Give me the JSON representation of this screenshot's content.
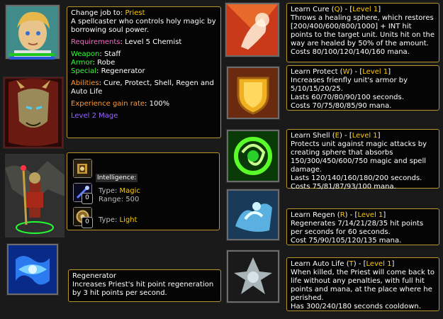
{
  "hero": {
    "change_job_label": "Change job to:",
    "job_name": "Priest",
    "description": "A spellcaster who controls holy magic by borrowing soul power.",
    "req_label": "Requirements",
    "req_value": ": Level 5 Chemist",
    "weapon_label": "Weapon",
    "weapon_value": ": Staff",
    "armor_label": "Armor",
    "armor_value": ": Robe",
    "special_label": "Special",
    "special_value": ": Regenerator",
    "abilities_label": "Abilities",
    "abilities_value": ": Cure, Protect, Shell, Regen and Auto Life",
    "exp_label": "Experience gain rate",
    "exp_value": ": 100%",
    "level_text": "Level 2 Mage"
  },
  "stats": {
    "intelligence_label": "Intelligence:",
    "attack_count": "0",
    "defense_count": "0",
    "type_label": "Type:",
    "attack_type": "Magic",
    "range_label": "Range:",
    "range_value": "500",
    "armor_type": "Light"
  },
  "special": {
    "title": "Regenerator",
    "desc": "Increases Priest's hit point regeneration by 3 hit points per second."
  },
  "skills": [
    {
      "name": "Learn Cure",
      "hotkey": "Q",
      "level": "Level 1",
      "desc": "Throws a healing sphere, which restores [200/400/600/800/1000] + INT hit points to the target unit. Units hit on the way are healed by 50% of the amount.",
      "cost": "Costs 80/100/120/140/160 mana.",
      "extra": ""
    },
    {
      "name": "Learn Protect",
      "hotkey": "W",
      "level": "Level 1",
      "desc": "Increases frienfly unit's armor by 5/10/15/20/25.",
      "cost": "Lasts 60/70/80/90/100 seconds.",
      "extra": "Costs 70/75/80/85/90 mana."
    },
    {
      "name": "Learn Shell",
      "hotkey": "E",
      "level": "Level 1",
      "desc": "Protects unit against magic attacks by creating sphere that absorbs 150/300/450/600/750 magic and spell damage.",
      "cost": "Lasts 120/140/160/180/200 seconds.",
      "extra": "Costs 75/81/87/93/100 mana."
    },
    {
      "name": "Learn Regen",
      "hotkey": "R",
      "level": "Level 1",
      "desc": "Regenerates 7/14/21/28/35 hit points per seconds for 60 seconds.",
      "cost": "Cost 75/90/105/120/135 mana.",
      "extra": ""
    },
    {
      "name": "Learn Auto Life",
      "hotkey": "T",
      "level": "Level 1",
      "desc": "When killed, the Priest will come back to life without any penalties, with full hit points and mana, at the place where he perished.",
      "cost": "Has 300/240/180 seconds cooldown.",
      "extra": ""
    }
  ],
  "colors": {
    "gold": "#ffcc00",
    "border": "#b8952a",
    "hp": "#1ec81e",
    "mana": "#2a5adc"
  },
  "icons": [
    "hero-portrait-icon",
    "gargoyle-portrait-icon",
    "priest-model",
    "regenerator-icon",
    "cure-icon",
    "protect-icon",
    "shell-icon",
    "regen-icon",
    "auto-life-icon",
    "intelligence-icon",
    "magic-attack-icon",
    "light-armor-icon"
  ]
}
